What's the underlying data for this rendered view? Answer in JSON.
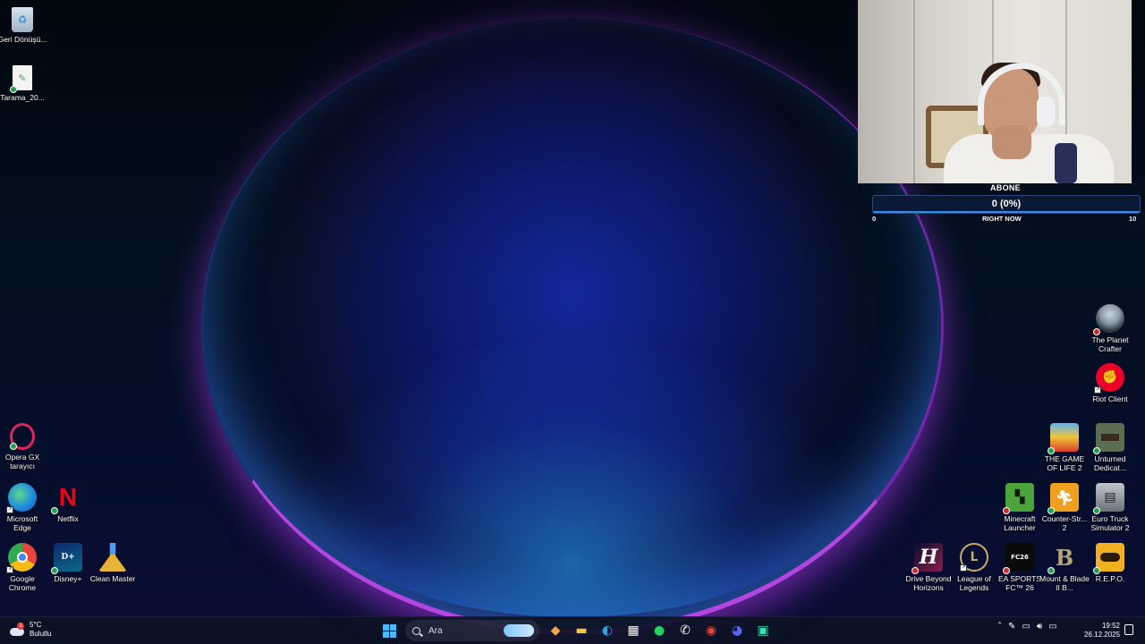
{
  "desktop": {
    "icons_left": [
      {
        "id": "recycle",
        "label": "Geri Dönüşü...",
        "icon": "recycle-bin-icon"
      },
      {
        "id": "scan",
        "label": "Tarama_20...",
        "icon": "document-icon"
      },
      {
        "id": "opera",
        "label": "Opera GX tarayıcı",
        "icon": "opera-gx-icon"
      },
      {
        "id": "edge",
        "label": "Microsoft Edge",
        "icon": "edge-icon"
      },
      {
        "id": "netflix",
        "label": "Netflix",
        "icon": "netflix-icon"
      },
      {
        "id": "chrome",
        "label": "Google Chrome",
        "icon": "chrome-icon"
      },
      {
        "id": "disney",
        "label": "Disney+",
        "icon": "disney-plus-icon"
      },
      {
        "id": "cleanmaster",
        "label": "Clean Master",
        "icon": "broom-icon"
      }
    ],
    "icons_right": [
      {
        "id": "planetcrafter",
        "label": "The Planet Crafter",
        "icon": "astronaut-icon"
      },
      {
        "id": "riot",
        "label": "Riot Client",
        "icon": "riot-fist-icon"
      },
      {
        "id": "gameoflife",
        "label": "THE GAME OF LIFE 2",
        "icon": "game-of-life-icon"
      },
      {
        "id": "unturned",
        "label": "Unturned Dedicat...",
        "icon": "unturned-icon"
      },
      {
        "id": "minecraft",
        "label": "Minecraft Launcher",
        "icon": "creeper-icon"
      },
      {
        "id": "counterstrike",
        "label": "Counter-Str... 2",
        "icon": "counter-strike-icon"
      },
      {
        "id": "eurotruck",
        "label": "Euro Truck Simulator 2",
        "icon": "truck-icon"
      },
      {
        "id": "drivebeyond",
        "label": "Drive Beyond Horizons",
        "icon": "drive-beyond-icon"
      },
      {
        "id": "lol",
        "label": "League of Legends",
        "icon": "league-icon"
      },
      {
        "id": "eafc",
        "label": "EA SPORTS FC™ 26",
        "icon": "ea-fc-icon"
      },
      {
        "id": "bannerlord",
        "label": "Mount & Blade II B...",
        "icon": "mount-blade-icon"
      },
      {
        "id": "repo",
        "label": "R.E.P.O.",
        "icon": "repo-robot-icon"
      }
    ]
  },
  "overlay": {
    "sub_title": "ABONE",
    "sub_value": "0 (0%)",
    "sub_min": "0",
    "sub_max": "10",
    "sub_mid": "RIGHT NOW",
    "sub_progress": 0
  },
  "taskbar": {
    "weather_temp": "5°C",
    "weather_desc": "Bulutlu",
    "weather_alert": "1",
    "search_placeholder": "Ara",
    "apps": [
      {
        "id": "copilot",
        "icon": "copilot-icon",
        "glyph": "◆",
        "color": "#f0a84a"
      },
      {
        "id": "explorer",
        "icon": "folder-icon",
        "glyph": "▬",
        "color": "#f3c744"
      },
      {
        "id": "edge",
        "icon": "edge-icon",
        "glyph": "◐",
        "color": "#2ba7e0"
      },
      {
        "id": "store",
        "icon": "store-icon",
        "glyph": "▦",
        "color": "#ffffff"
      },
      {
        "id": "spotify",
        "icon": "spotify-icon",
        "glyph": "●",
        "color": "#1ed760"
      },
      {
        "id": "whatsapp",
        "icon": "whatsapp-icon",
        "glyph": "✆",
        "color": "#ffffff"
      },
      {
        "id": "chrome",
        "icon": "chrome-icon",
        "glyph": "◉",
        "color": "#e8453c"
      },
      {
        "id": "discord",
        "icon": "discord-icon",
        "glyph": "◕",
        "color": "#5865f2"
      },
      {
        "id": "terminal",
        "icon": "terminal-app-icon",
        "glyph": "▣",
        "color": "#2ee6b0"
      }
    ],
    "tray_icons": [
      "chevron-up-icon",
      "pen-icon",
      "network-icon",
      "volume-icon",
      "battery-icon"
    ],
    "time": "19:52",
    "date": "26.12.2025"
  }
}
